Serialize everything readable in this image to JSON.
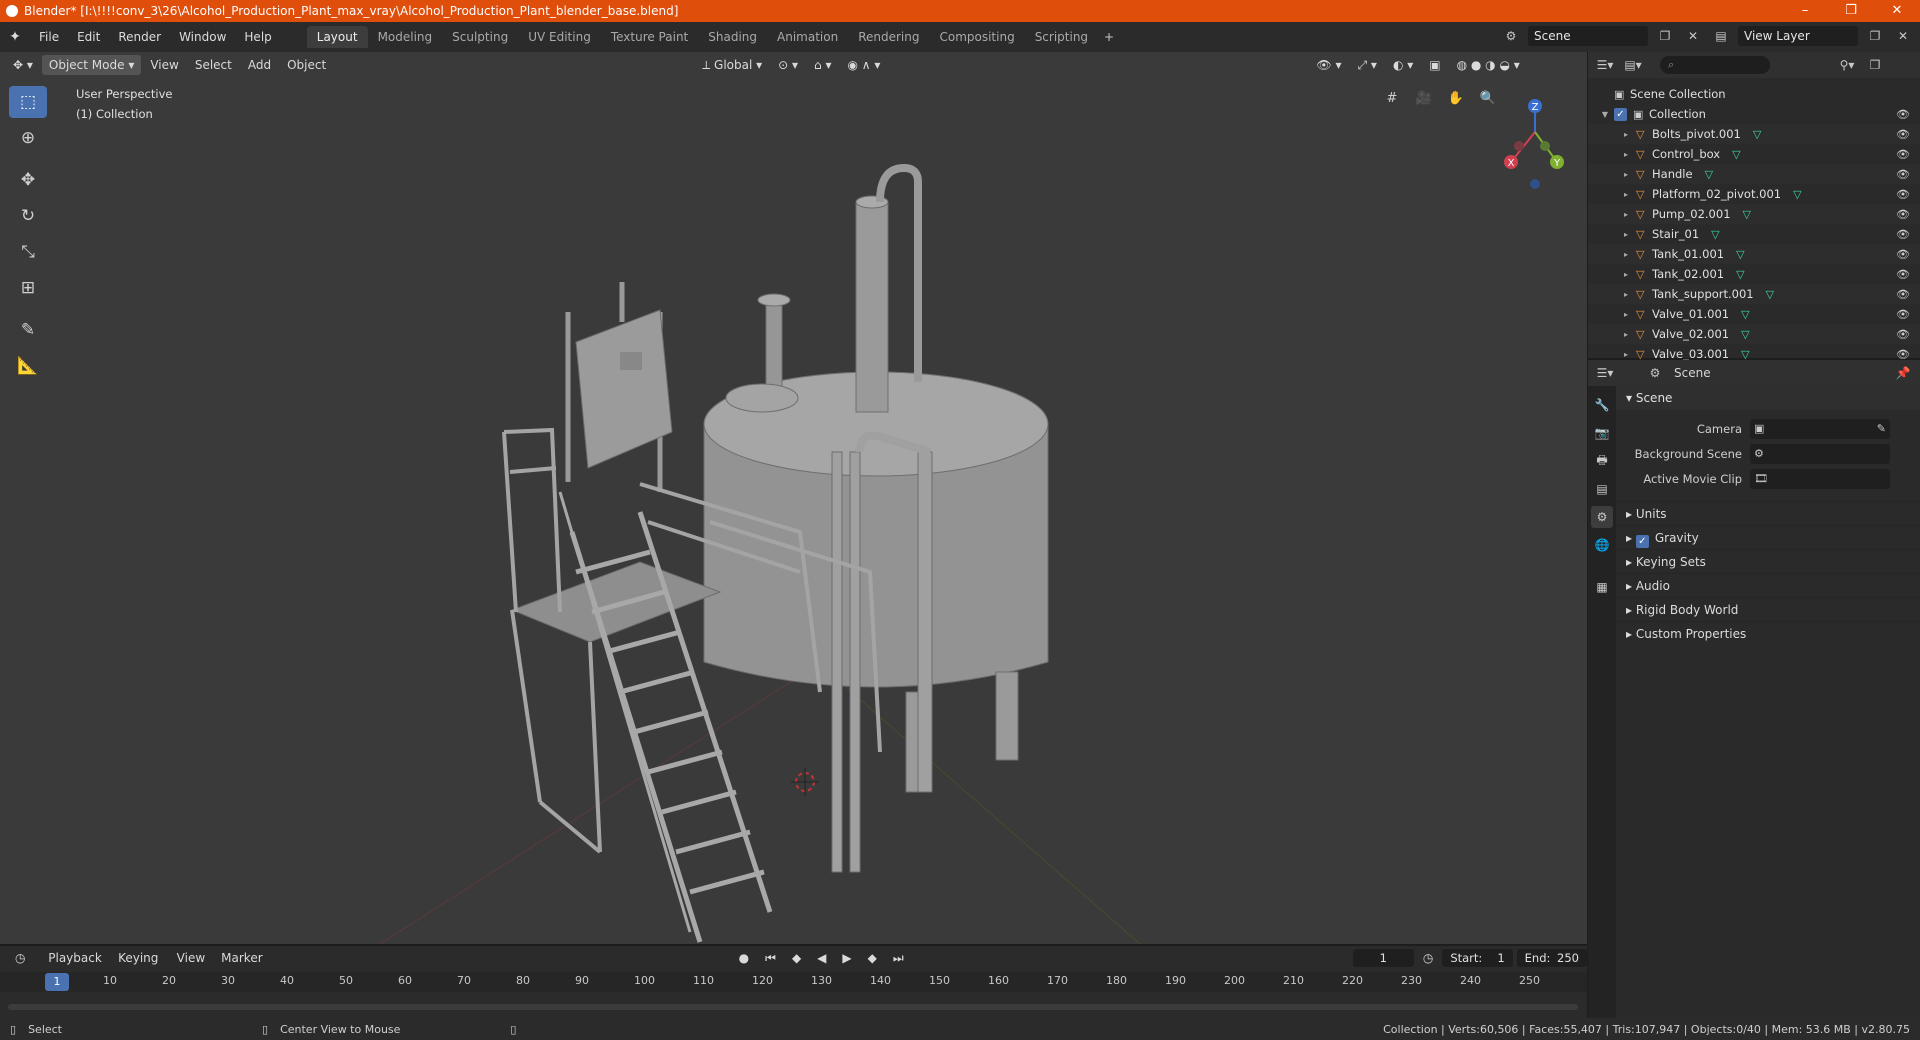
{
  "window": {
    "title": "Blender* [I:\\!!!!conv_3\\26\\Alcohol_Production_Plant_max_vray\\Alcohol_Production_Plant_blender_base.blend]",
    "controls": [
      "–",
      "❐",
      "✕"
    ]
  },
  "menu": [
    "File",
    "Edit",
    "Render",
    "Window",
    "Help"
  ],
  "workspaces": [
    "Layout",
    "Modeling",
    "Sculpting",
    "UV Editing",
    "Texture Paint",
    "Shading",
    "Animation",
    "Rendering",
    "Compositing",
    "Scripting"
  ],
  "active_workspace": "Layout",
  "scene_name": "Scene",
  "view_layer": "View Layer",
  "viewport": {
    "mode": "Object Mode",
    "menus": [
      "View",
      "Select",
      "Add",
      "Object"
    ],
    "transform_orientation": "Global",
    "perspective_label": "User Perspective",
    "collection_label": "(1) Collection",
    "gizmo": {
      "x": "X",
      "y": "Y",
      "z": "Z"
    }
  },
  "outliner": {
    "root": "Scene Collection",
    "collection": "Collection",
    "items": [
      "Bolts_pivot.001",
      "Control_box",
      "Handle",
      "Platform_02_pivot.001",
      "Pump_02.001",
      "Stair_01",
      "Tank_01.001",
      "Tank_02.001",
      "Tank_support.001",
      "Valve_01.001",
      "Valve_02.001",
      "Valve_03.001"
    ]
  },
  "properties": {
    "header": "Scene",
    "panel": "Scene",
    "fields": [
      {
        "label": "Camera",
        "value": ""
      },
      {
        "label": "Background Scene",
        "value": ""
      },
      {
        "label": "Active Movie Clip",
        "value": ""
      }
    ],
    "subpanels": [
      "Units",
      "Gravity",
      "Keying Sets",
      "Audio",
      "Rigid Body World",
      "Custom Properties"
    ]
  },
  "timeline": {
    "menus": [
      "Playback",
      "Keying",
      "View",
      "Marker"
    ],
    "current_frame": "1",
    "start_label": "Start:",
    "start": "1",
    "end_label": "End:",
    "end": "250",
    "ticks": [
      "10",
      "20",
      "30",
      "40",
      "50",
      "60",
      "70",
      "80",
      "90",
      "100",
      "110",
      "120",
      "130",
      "140",
      "150",
      "160",
      "170",
      "180",
      "190",
      "200",
      "210",
      "220",
      "230",
      "240",
      "250"
    ]
  },
  "status": {
    "left": "Select",
    "middle": "Center View to Mouse",
    "right": "Collection | Verts:60,506 | Faces:55,407 | Tris:107,947 | Objects:0/40 | Mem: 53.6 MB | v2.80.75"
  },
  "colors": {
    "title_bar": "#e04e0c",
    "accent_blue": "#4a72b1",
    "object_orange": "#e7953c",
    "mesh_green": "#3ed6a0"
  }
}
